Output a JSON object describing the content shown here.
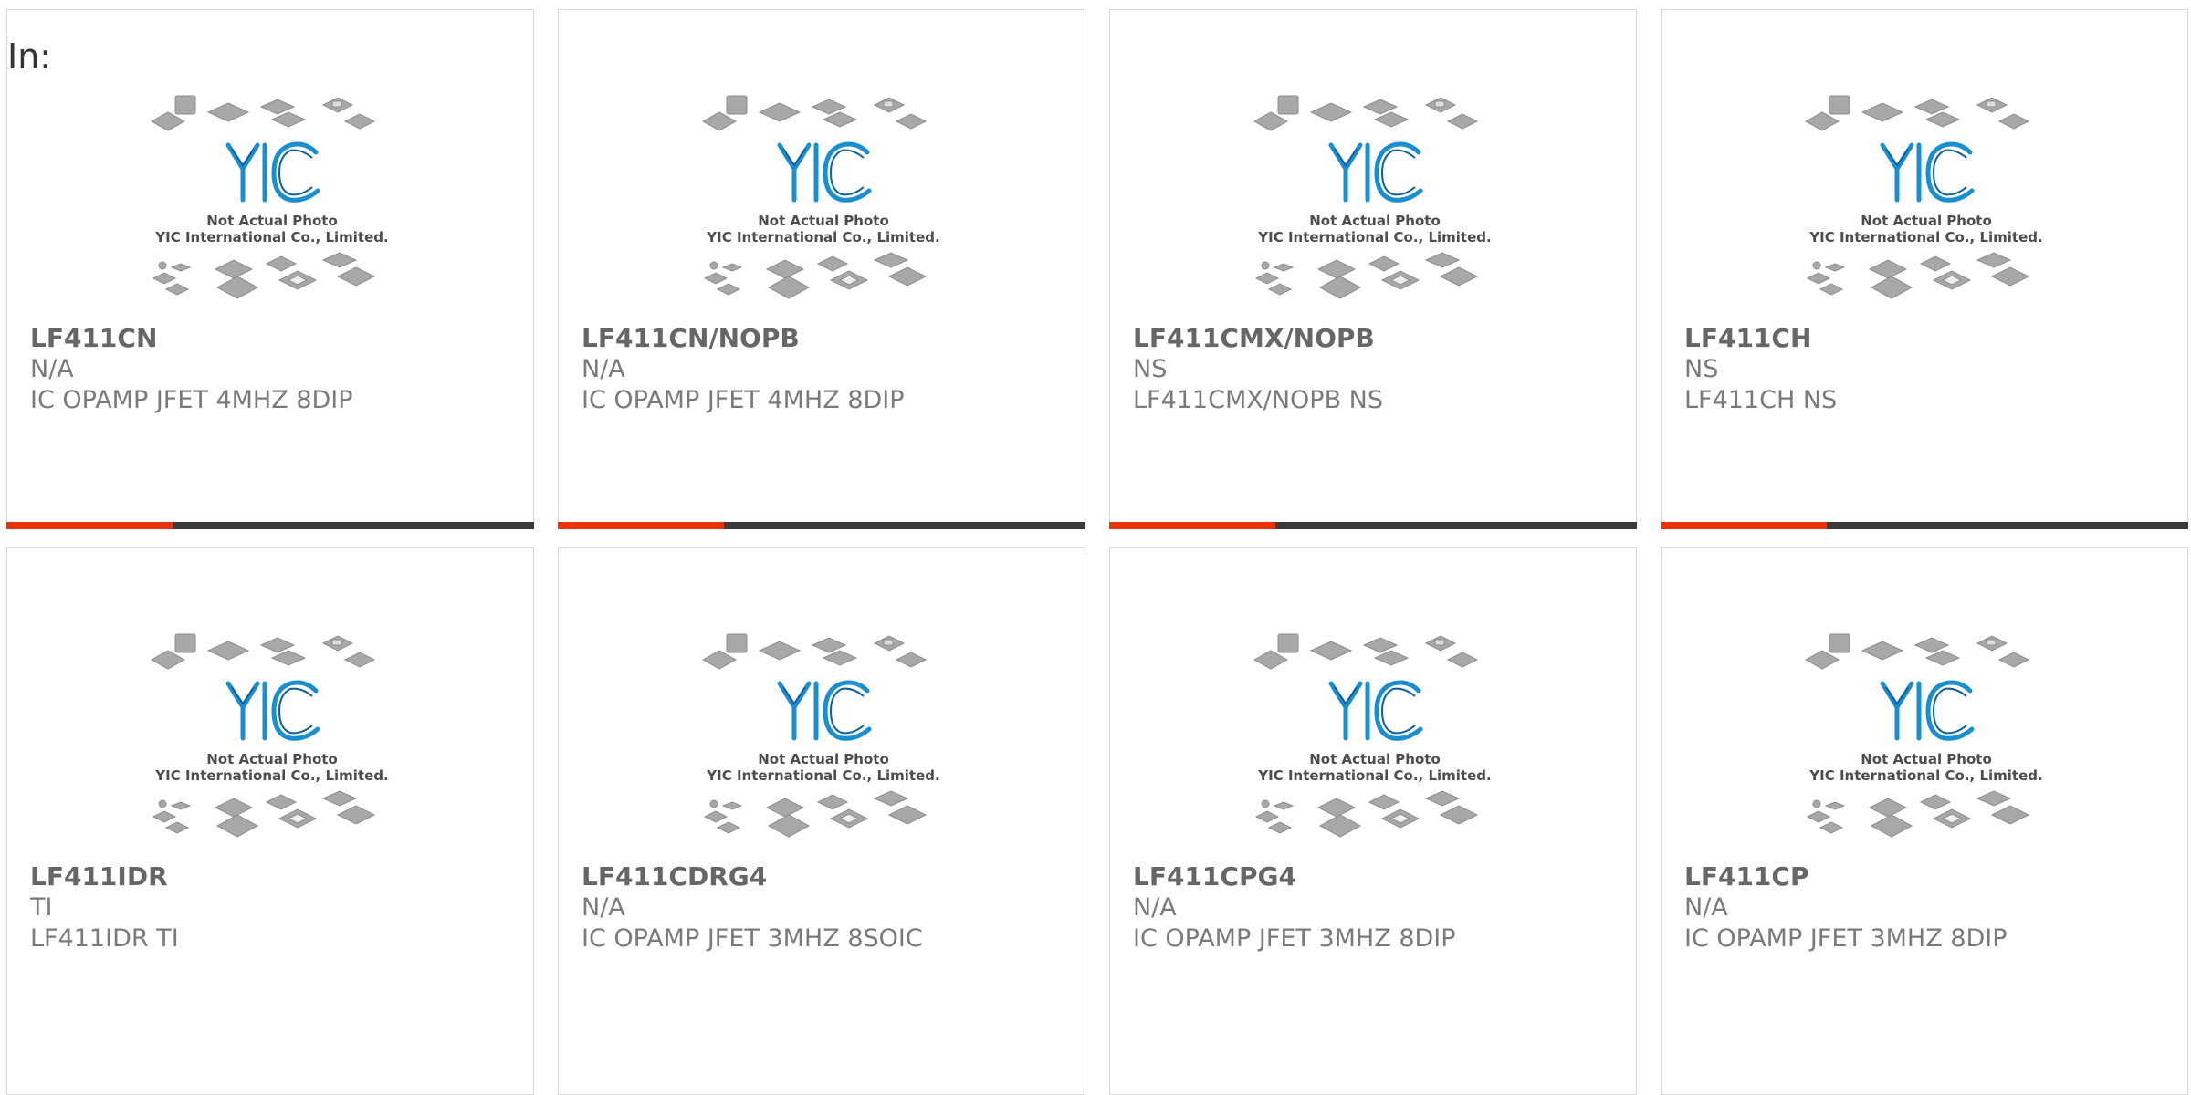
{
  "header": {
    "in_label": "In:"
  },
  "placeholder": {
    "logo_text": "YIC",
    "caption_line1": "Not Actual Photo",
    "caption_line2": "YIC International Co., Limited."
  },
  "colors": {
    "accent": "#e8340c",
    "bar": "#3a3a3a",
    "logo": "#1a8fd0",
    "border": "#d9d9d9"
  },
  "products": [
    {
      "part": "LF411CN",
      "manufacturer": "N/A",
      "description": "IC OPAMP JFET 4MHZ 8DIP"
    },
    {
      "part": "LF411CN/NOPB",
      "manufacturer": "N/A",
      "description": "IC OPAMP JFET 4MHZ 8DIP"
    },
    {
      "part": "LF411CMX/NOPB",
      "manufacturer": "NS",
      "description": "LF411CMX/NOPB NS"
    },
    {
      "part": "LF411CH",
      "manufacturer": "NS",
      "description": "LF411CH NS"
    },
    {
      "part": "LF411IDR",
      "manufacturer": "TI",
      "description": "LF411IDR TI"
    },
    {
      "part": "LF411CDRG4",
      "manufacturer": "N/A",
      "description": "IC OPAMP JFET 3MHZ 8SOIC"
    },
    {
      "part": "LF411CPG4",
      "manufacturer": "N/A",
      "description": "IC OPAMP JFET 3MHZ 8DIP"
    },
    {
      "part": "LF411CP",
      "manufacturer": "N/A",
      "description": "IC OPAMP JFET 3MHZ 8DIP"
    }
  ]
}
